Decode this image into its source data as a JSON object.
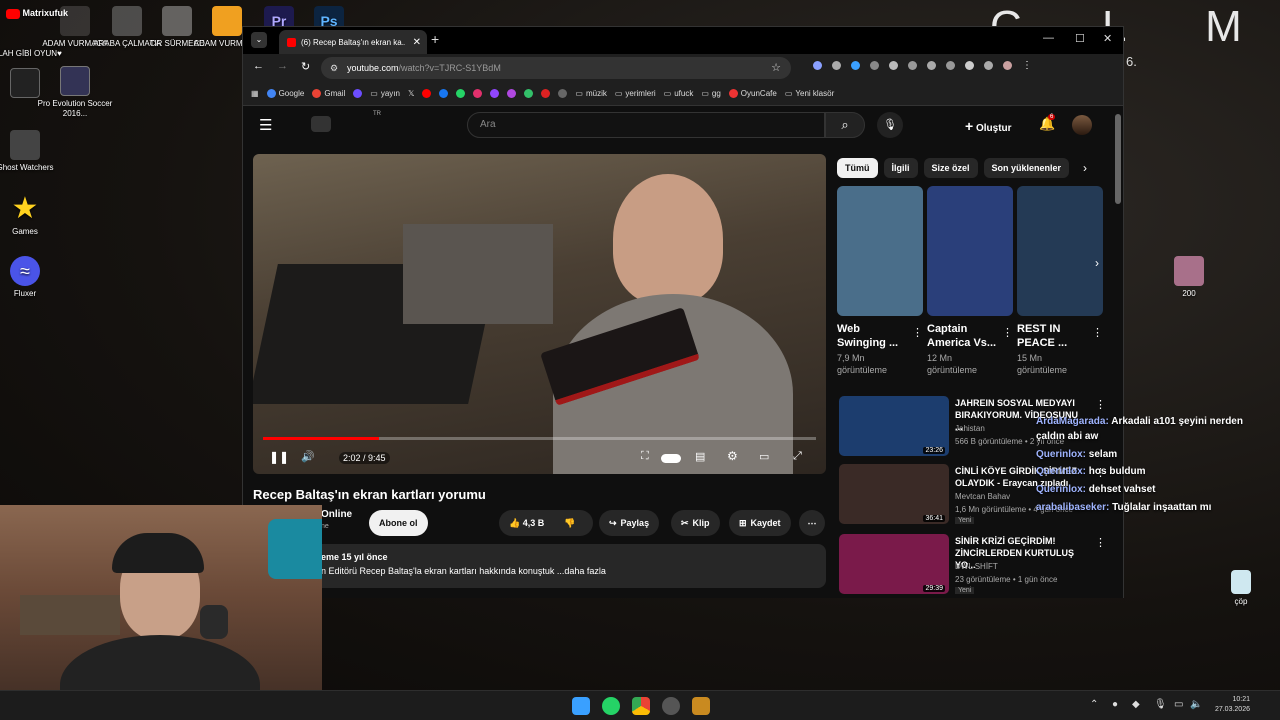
{
  "desktop": {
    "brand": "C L M A",
    "small": "6.",
    "icons": [
      {
        "label": "Matrixufuk"
      },
      {
        "label": "ALLAH GİBİ OYUN♥"
      },
      {
        "label": "ADAM VURMACA"
      },
      {
        "label": "ARABA ÇALMACA"
      },
      {
        "label": "TIR SÜRMECE"
      },
      {
        "label": "ADAM VURMAC..."
      },
      {
        "label": "Pro Evolution Soccer 2016..."
      },
      {
        "label": "Ghost Watchers"
      },
      {
        "label": "Games"
      },
      {
        "label": "Fluxer"
      },
      {
        "label": "200"
      },
      {
        "label": "çöp"
      }
    ]
  },
  "browser": {
    "tab_title": "(6) Recep Baltaş'ın ekran ka...",
    "url_host": "youtube.com",
    "url_path": "/watch?v=TJRC-S1YBdM",
    "bookmarks": [
      "Google",
      "Gmail",
      "yayın",
      "müzik",
      "yerimleri",
      "ufuck",
      "gg",
      "OyunCafe",
      "Yeni klasör"
    ]
  },
  "youtube": {
    "region": "TR",
    "search_placeholder": "Ara",
    "create_label": "Oluştur",
    "notif_count": "6",
    "player": {
      "time": "2:02 / 9:45",
      "progress": 0.21
    },
    "video_title": "Recep Baltaş'ın ekran kartları yorumu",
    "channel_fragment": "Online",
    "channel_sub": "ne",
    "subscribe": "Abone ol",
    "likes": "4,3 B",
    "share": "Paylaş",
    "clip": "Klip",
    "save": "Kaydet",
    "desc_meta": "eme  15 yıl önce",
    "desc_text": "n Editörü Recep Baltaş'la ekran kartları hakkında konuştuk ...daha fazla",
    "chips": [
      "Tümü",
      "İlgili",
      "Size özel",
      "Son yüklenenler"
    ],
    "shorts": [
      {
        "title": "Web Swinging ...",
        "views": "7,9 Mn görüntüleme",
        "color": "#4a6e8a"
      },
      {
        "title": "Captain America Vs...",
        "views": "12 Mn görüntüleme",
        "color": "#2a3f7a"
      },
      {
        "title": "REST IN PEACE ...",
        "views": "15 Mn görüntüleme",
        "color": "#243a55"
      }
    ],
    "videos": [
      {
        "title": "JAHREIN SOSYAL MEDYAYI BIRAKIYORUM. VİDEOSUNU ...",
        "channel": "Jahistan",
        "meta": "566 B görüntüleme • 2 yıl önce",
        "duration": "23:26",
        "new": "",
        "color": "#1c3d6e"
      },
      {
        "title": "CİNLİ KÖYE GİRDİK ŞİRMEZ OLAYDIK - Eraycan zıpladı",
        "channel": "Mevtcan Bahav",
        "meta": "1,6 Mn görüntüleme • 4 gün önce",
        "duration": "36:41",
        "new": "Yeni",
        "color": "#3a2a26"
      },
      {
        "title": "SİNİR KRİZİ GEÇİRDİM! ZİNCİRLERDEN KURTULUŞ YO...",
        "channel": "DWL SHİFT",
        "meta": "23 görüntüleme • 1 gün önce",
        "duration": "29:39",
        "new": "Yeni",
        "color": "#7a1a4a"
      }
    ]
  },
  "chat": [
    {
      "name": "ArdaMagarada:",
      "msg": "Arkadali a101 şeyini nerden"
    },
    {
      "name": "",
      "msg": "çaldın abi aw"
    },
    {
      "name": "Querinlox:",
      "msg": "selam"
    },
    {
      "name": "Querinlox:",
      "msg": "hos buldum"
    },
    {
      "name": "Querinlox:",
      "msg": "dehset vahset"
    },
    {
      "name": "arabalibaseker:",
      "msg": "Tuğlalar inşaattan mı"
    }
  ],
  "clock": {
    "time": "10:21",
    "date": "27.03.2026"
  }
}
